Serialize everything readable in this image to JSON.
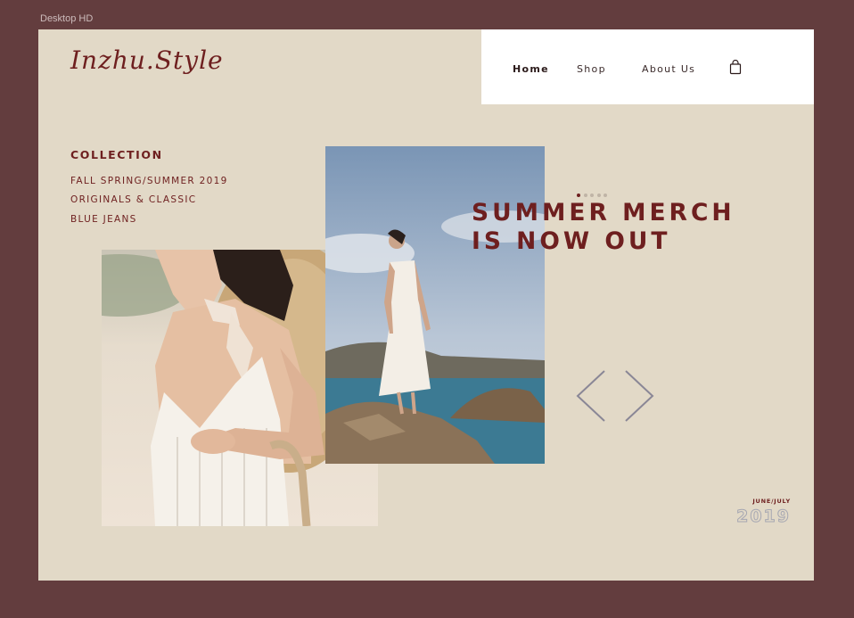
{
  "frame": {
    "label": "Desktop HD"
  },
  "brand": {
    "logo": "Inzhu.Style"
  },
  "nav": {
    "items": [
      {
        "label": "Home",
        "active": true
      },
      {
        "label": "Shop",
        "active": false
      },
      {
        "label": "About Us",
        "active": false
      }
    ],
    "cart_icon": "shopping-bag-icon"
  },
  "collection": {
    "title": "COLLECTION",
    "links": [
      "FALL SPRING/SUMMER 2019",
      "ORIGINALS & CLASSIC",
      "BLUE JEANS"
    ]
  },
  "hero": {
    "headline_line1": "SUMMER MERCH",
    "headline_line2": "IS NOW OUT",
    "slides_total": 5,
    "slide_active": 1,
    "prev_icon": "chevron-left-icon",
    "next_icon": "chevron-right-icon"
  },
  "footer": {
    "season": "JUNE/JULY",
    "year": "2019"
  },
  "colors": {
    "frame_bg": "#633d3e",
    "artboard_bg": "#e2d9c7",
    "accent": "#6e1f1f",
    "nav_bg": "#ffffff",
    "arrow": "#8a8796"
  }
}
